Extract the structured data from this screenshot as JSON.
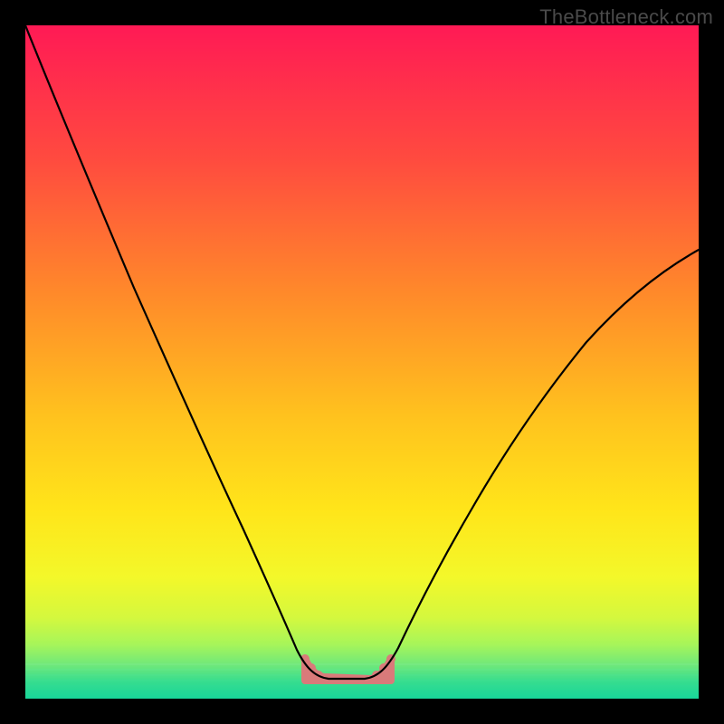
{
  "watermark": "TheBottleneck.com",
  "chart_data": {
    "type": "line",
    "title": "",
    "xlabel": "",
    "ylabel": "",
    "xlim": [
      0,
      1
    ],
    "ylim": [
      0,
      1
    ],
    "note": "Axes are unlabeled; coordinates are normalized (0=left/bottom, 1=right/top). The curve is a V-shaped bottleneck profile with a flat valley near y≈0.03 and a small salmon highlight marking the optimal range at the valley.",
    "series": [
      {
        "name": "bottleneck-curve",
        "color": "#000000",
        "x": [
          0.0,
          0.05,
          0.1,
          0.15,
          0.2,
          0.25,
          0.3,
          0.34,
          0.37,
          0.395,
          0.415,
          0.43,
          0.455,
          0.48,
          0.505,
          0.52,
          0.54,
          0.57,
          0.61,
          0.66,
          0.72,
          0.8,
          0.88,
          0.95,
          1.0
        ],
        "y": [
          1.0,
          0.87,
          0.74,
          0.61,
          0.49,
          0.38,
          0.27,
          0.19,
          0.13,
          0.08,
          0.05,
          0.03,
          0.03,
          0.03,
          0.03,
          0.05,
          0.08,
          0.14,
          0.22,
          0.31,
          0.4,
          0.49,
          0.56,
          0.61,
          0.64
        ]
      }
    ],
    "highlight": {
      "name": "optimal-range",
      "color": "#d97a7a",
      "x_range": [
        0.415,
        0.525
      ],
      "y_top_approx": [
        0.06,
        0.033,
        0.03,
        0.03,
        0.03,
        0.033,
        0.06
      ],
      "y_bottom": 0.025
    },
    "background": {
      "type": "vertical-gradient",
      "stops": [
        {
          "pos": 0.0,
          "color": "#ff1a55"
        },
        {
          "pos": 0.2,
          "color": "#ff4b3f"
        },
        {
          "pos": 0.4,
          "color": "#ff8a2a"
        },
        {
          "pos": 0.58,
          "color": "#ffc21e"
        },
        {
          "pos": 0.72,
          "color": "#ffe51a"
        },
        {
          "pos": 0.82,
          "color": "#f3f82a"
        },
        {
          "pos": 0.88,
          "color": "#d4f83e"
        },
        {
          "pos": 0.92,
          "color": "#a6f55a"
        },
        {
          "pos": 0.95,
          "color": "#6fe87a"
        },
        {
          "pos": 0.975,
          "color": "#36dd8e"
        },
        {
          "pos": 1.0,
          "color": "#18d69a"
        }
      ],
      "green_band_y": [
        0.0,
        0.05
      ]
    }
  }
}
